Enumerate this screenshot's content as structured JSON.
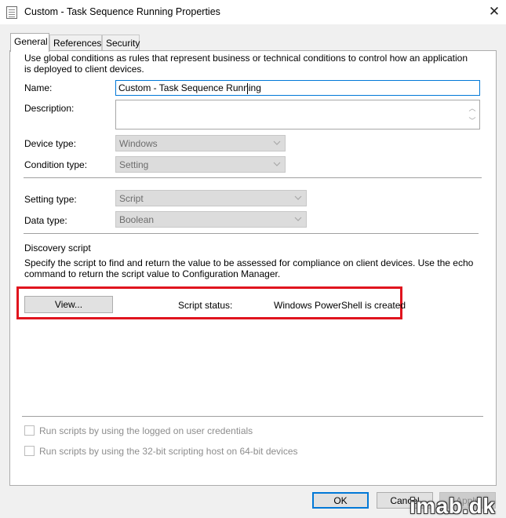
{
  "window": {
    "title": "Custom - Task Sequence Running Properties",
    "close_glyph": "✕",
    "title_icon": "properties-document-icon"
  },
  "tabs": [
    {
      "label": "General",
      "active": true
    },
    {
      "label": "References",
      "active": false
    },
    {
      "label": "Security",
      "active": false
    }
  ],
  "general": {
    "intro": "Use global conditions as rules that represent business or technical conditions to control how an application is deployed to client devices.",
    "name_label": "Name:",
    "name_value": "Custom - Task Sequence Running",
    "description_label": "Description:",
    "description_value": "",
    "device_type_label": "Device type:",
    "device_type_value": "Windows",
    "condition_type_label": "Condition type:",
    "condition_type_value": "Setting",
    "setting_type_label": "Setting type:",
    "setting_type_value": "Script",
    "data_type_label": "Data type:",
    "data_type_value": "Boolean",
    "discovery_heading": "Discovery script",
    "discovery_desc": "Specify the script to find and return the value to be assessed for compliance on client devices. Use the echo command to return the script value to Configuration Manager.",
    "view_button": "View...",
    "script_status_label": "Script status:",
    "script_status_value": "Windows PowerShell is created",
    "run_logged_on": "Run scripts by using the logged on user credentials",
    "run_32bit": "Run scripts by using the 32-bit scripting host on 64-bit devices"
  },
  "footer": {
    "ok": "OK",
    "cancel": "Cancel",
    "apply": "Apply"
  },
  "watermark": "imab.dk",
  "colors": {
    "highlight": "#e0141e",
    "focus_border": "#0078d7"
  }
}
